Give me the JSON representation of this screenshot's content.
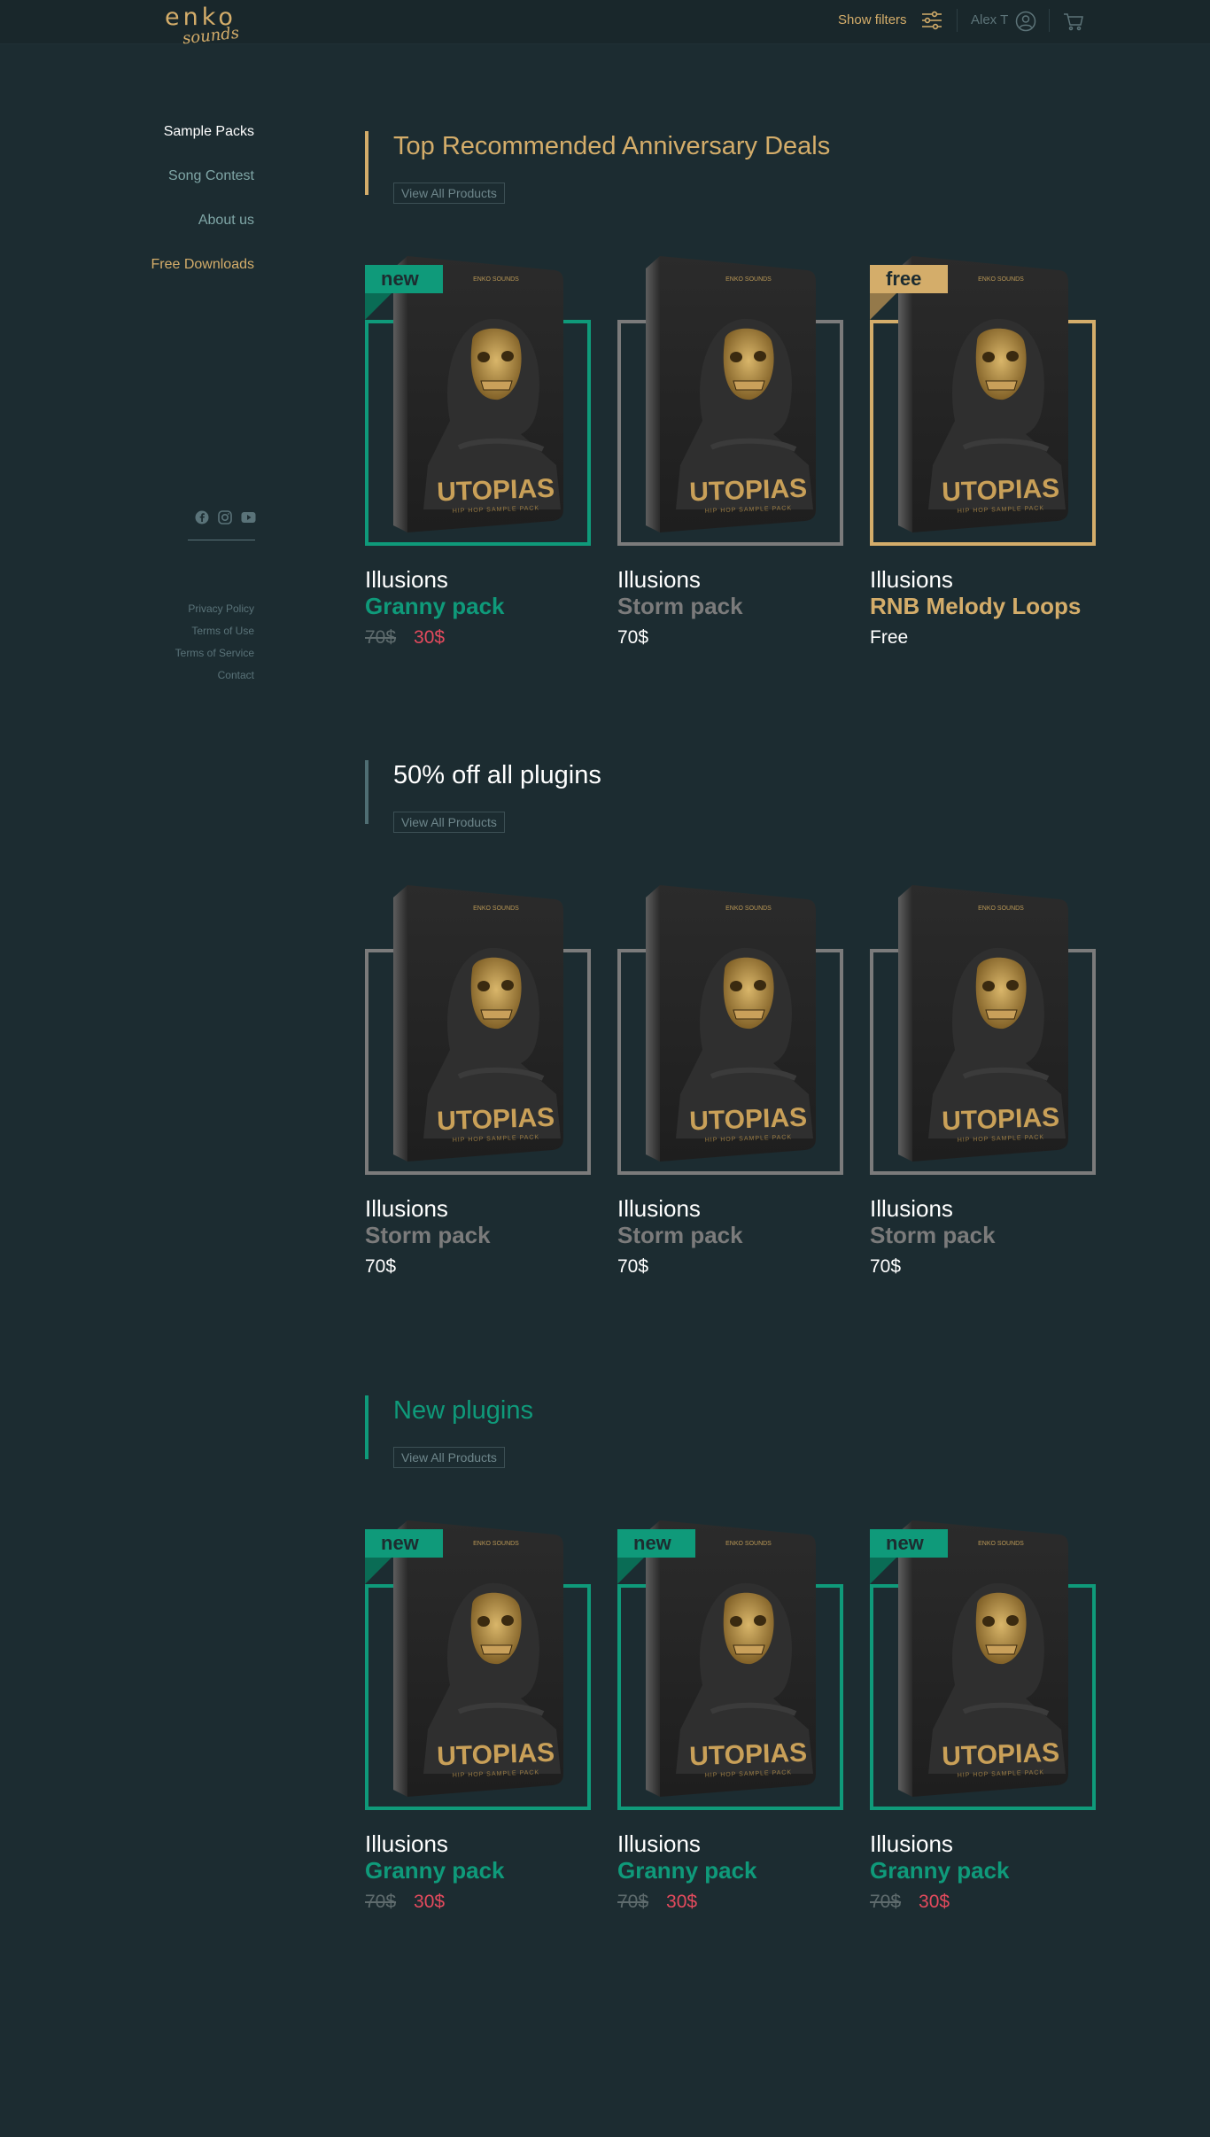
{
  "header": {
    "logo_text": "enko",
    "logo_script": "sounds",
    "show_filters": "Show filters",
    "user_name": "Alex T"
  },
  "sidebar": {
    "items": [
      {
        "label": "Sample Packs",
        "color": "#ffffff"
      },
      {
        "label": "Song Contest",
        "color": "#7fa6a6"
      },
      {
        "label": "About us",
        "color": "#7fa6a6"
      },
      {
        "label": "Free Downloads",
        "color": "#d4ad6a"
      }
    ],
    "social_icons": [
      "facebook-icon",
      "instagram-icon",
      "youtube-icon"
    ],
    "footer_links": [
      "Privacy Policy",
      "Terms of Use",
      "Terms of Service",
      "Contact"
    ]
  },
  "product_art": {
    "brand": "ENKO SOUNDS",
    "title": "UTOPIAS",
    "subtitle": "HIP HOP SAMPLE PACK"
  },
  "sections": [
    {
      "title": "Top Recommended Anniversary Deals",
      "title_color": "#d4ad6a",
      "bar_color": "#d4ad6a",
      "view_all": "View All Products",
      "products": [
        {
          "badge": "new",
          "brand": "Illusions",
          "name": "Granny pack",
          "old_price": "70$",
          "price": "30$",
          "accent": "#0f9a7a"
        },
        {
          "badge": "",
          "brand": "Illusions",
          "name": "Storm pack",
          "old_price": "",
          "price": "70$",
          "accent": "#7b7b7b"
        },
        {
          "badge": "free",
          "brand": "Illusions",
          "name": "RNB Melody Loops",
          "old_price": "",
          "price": "Free",
          "accent": "#d4ad6a"
        }
      ]
    },
    {
      "title": "50% off all plugins",
      "title_color": "#ffffff",
      "bar_color": "#4f6e73",
      "view_all": "View All Products",
      "products": [
        {
          "badge": "",
          "brand": "Illusions",
          "name": "Storm pack",
          "old_price": "",
          "price": "70$",
          "accent": "#7b7b7b"
        },
        {
          "badge": "",
          "brand": "Illusions",
          "name": "Storm pack",
          "old_price": "",
          "price": "70$",
          "accent": "#7b7b7b"
        },
        {
          "badge": "",
          "brand": "Illusions",
          "name": "Storm pack",
          "old_price": "",
          "price": "70$",
          "accent": "#7b7b7b"
        }
      ]
    },
    {
      "title": "New plugins",
      "title_color": "#0f9a7a",
      "bar_color": "#0f9a7a",
      "view_all": "View All Products",
      "products": [
        {
          "badge": "new",
          "brand": "Illusions",
          "name": "Granny pack",
          "old_price": "70$",
          "price": "30$",
          "accent": "#0f9a7a"
        },
        {
          "badge": "new",
          "brand": "Illusions",
          "name": "Granny pack",
          "old_price": "70$",
          "price": "30$",
          "accent": "#0f9a7a"
        },
        {
          "badge": "new",
          "brand": "Illusions",
          "name": "Granny pack",
          "old_price": "70$",
          "price": "30$",
          "accent": "#0f9a7a"
        }
      ]
    }
  ]
}
